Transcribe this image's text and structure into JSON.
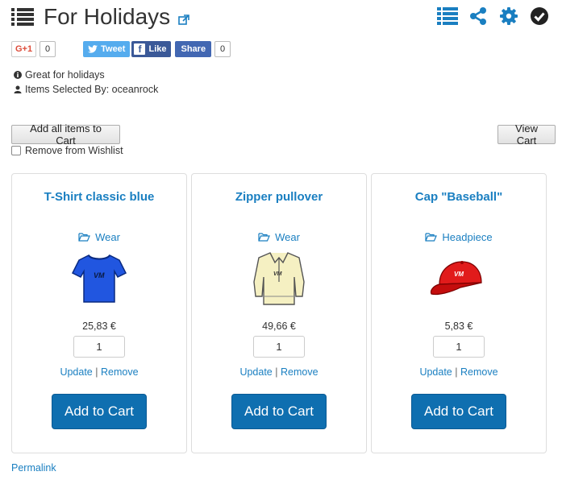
{
  "header": {
    "title": "For Holidays",
    "icons": [
      "list-icon",
      "external-link-icon",
      "list-view-icon",
      "share-icon",
      "gear-icon",
      "check-circle-icon"
    ]
  },
  "social": {
    "gplus_label": "G+1",
    "gplus_count": "0",
    "tweet_label": "Tweet",
    "like_label": "Like",
    "share_label": "Share",
    "share_count": "0",
    "fb_letter": "f"
  },
  "info": {
    "description": "Great for holidays",
    "selected_by": "Items Selected By: oceanrock"
  },
  "actions": {
    "add_all_label": "Add all items to Cart",
    "view_cart_label": "View Cart",
    "remove_wishlist_label": "Remove from Wishlist"
  },
  "products": [
    {
      "name": "T-Shirt classic blue",
      "category": "Wear",
      "price": "25,83 €",
      "qty": "1",
      "update_label": "Update",
      "separator": "|",
      "remove_label": "Remove",
      "cart_label": "Add to Cart"
    },
    {
      "name": "Zipper pullover",
      "category": "Wear",
      "price": "49,66 €",
      "qty": "1",
      "update_label": "Update",
      "separator": "|",
      "remove_label": "Remove",
      "cart_label": "Add to Cart"
    },
    {
      "name": "Cap \"Baseball\"",
      "category": "Headpiece",
      "price": "5,83 €",
      "qty": "1",
      "update_label": "Update",
      "separator": "|",
      "remove_label": "Remove",
      "cart_label": "Add to Cart"
    }
  ],
  "footer": {
    "permalink_label": "Permalink"
  },
  "colors": {
    "accent": "#1a7fc1",
    "button": "#0f6fb0",
    "tweet": "#55acee",
    "facebook": "#3b5998",
    "gplus": "#dd4b39"
  }
}
